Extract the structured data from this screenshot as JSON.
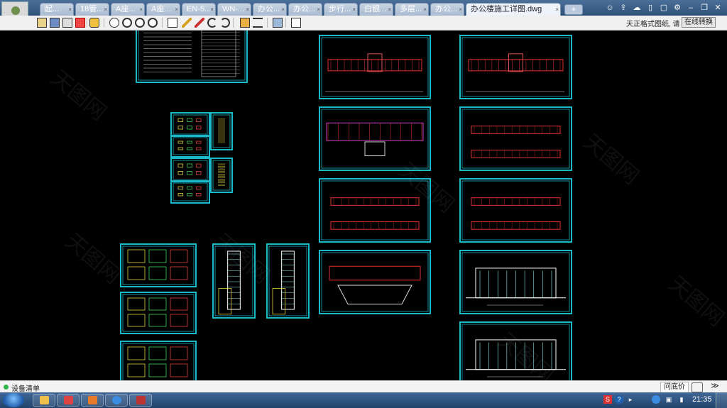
{
  "tabs": [
    {
      "label": "起..."
    },
    {
      "label": "18管..."
    },
    {
      "label": "A座..."
    },
    {
      "label": "A座..."
    },
    {
      "label": "EN-5..."
    },
    {
      "label": "WN-..."
    },
    {
      "label": "办公..."
    },
    {
      "label": "办公..."
    },
    {
      "label": "步行..."
    },
    {
      "label": "白银..."
    },
    {
      "label": "多层..."
    },
    {
      "label": "办公..."
    }
  ],
  "active_tab": {
    "label": "办公楼施工详图.dwg"
  },
  "new_tab_label": "+",
  "title_icons": [
    "users-icon",
    "share-icon",
    "cloud-icon",
    "phone-icon",
    "window-icon",
    "settings-icon",
    "minimize-icon",
    "restore-icon",
    "close-icon"
  ],
  "toolbar": {
    "icons": [
      "open-icon",
      "save-icon",
      "print-icon",
      "pdf-icon",
      "lock-icon",
      "pan-icon",
      "zoom-in-icon",
      "zoom-window-icon",
      "zoom-extents-icon",
      "text-icon",
      "pencil-icon",
      "highlighter-icon",
      "undo-icon",
      "redo-icon",
      "measure-icon",
      "distance-icon",
      "layers-icon",
      "properties-icon"
    ],
    "format_note": "天正格式图纸, 请",
    "convert_label": "在线转换"
  },
  "status": {
    "text": "设备清单",
    "ask_price": "问底价",
    "more": "≫"
  },
  "taskbar": {
    "clock": "21:35"
  },
  "watermark": "天图网",
  "colors": {
    "frame": "#19b9c8",
    "accent": "#2fb54a",
    "tab_active": "#eef3f9"
  }
}
